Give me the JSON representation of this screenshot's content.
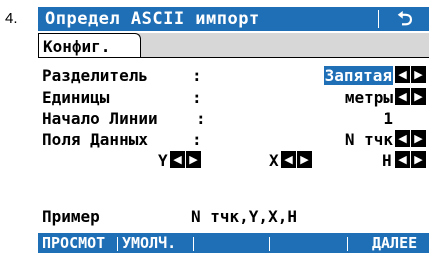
{
  "step_number": "4.",
  "title": "Определ ASCII импорт",
  "back_icon_glyph": "⮌",
  "tab": "Конфиг.",
  "fields": {
    "delimiter": {
      "label": "Разделитель",
      "colon": ":",
      "value": "Запятая"
    },
    "units": {
      "label": "Единицы",
      "colon": ":",
      "value": "метры"
    },
    "start_line": {
      "label": "Начало Линии",
      "colon": ":",
      "value": "1"
    },
    "data_fields": {
      "label": "Поля Данных",
      "colon": ":",
      "value": "N тчк"
    }
  },
  "coord_fields": {
    "y": "Y",
    "x": "X",
    "h": "H"
  },
  "example": {
    "label": "Пример",
    "value": "N тчк,Y,X,H"
  },
  "softkeys": [
    "ПРОСМОТ",
    "УМОЛЧ.",
    "",
    "",
    "ДАЛЕЕ"
  ],
  "arrow_left": "◀",
  "arrow_right": "▶",
  "colors": {
    "accent": "#1f6fb6",
    "tabstrip": "#d7d7d7"
  }
}
